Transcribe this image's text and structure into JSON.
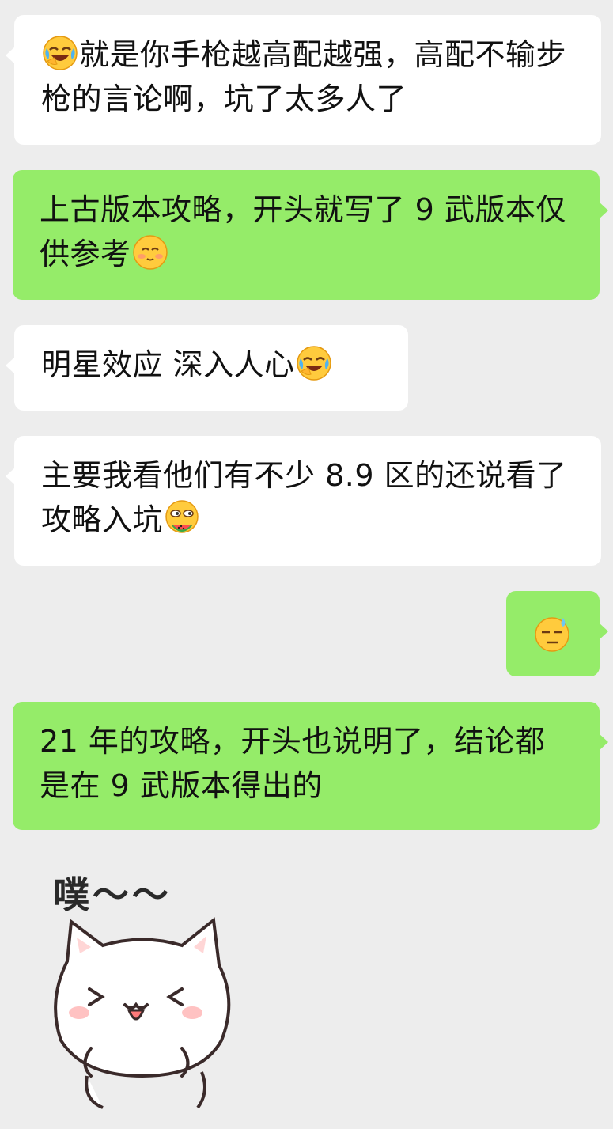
{
  "messages": [
    {
      "side": "in",
      "emoji_before": "laughing-crying-emoji",
      "text": "就是你手枪越高配越强，高配不输步枪的言论啊，坑了太多人了"
    },
    {
      "side": "out",
      "text": "上古版本攻略，开头就写了 9 武版本仅供参考",
      "emoji_after": "blushing-smile-emoji"
    },
    {
      "side": "in",
      "text": "明星效应 深入人心",
      "emoji_after": "laughing-crying-emoji"
    },
    {
      "side": "in",
      "text": "主要我看他们有不少 8.9 区的还说看了攻略入坑",
      "emoji_after": "eating-watermelon-emoji"
    },
    {
      "side": "out",
      "emoji_only": "sweat-emoji"
    },
    {
      "side": "out",
      "text": "21 年的攻略，开头也说明了，结论都是在 9 武版本得出的"
    }
  ],
  "sticker": {
    "text": "噗～～",
    "icon": "white-cat-sticker"
  },
  "colors": {
    "background": "#ededed",
    "incoming_bubble": "#ffffff",
    "outgoing_bubble": "#95ec69"
  }
}
